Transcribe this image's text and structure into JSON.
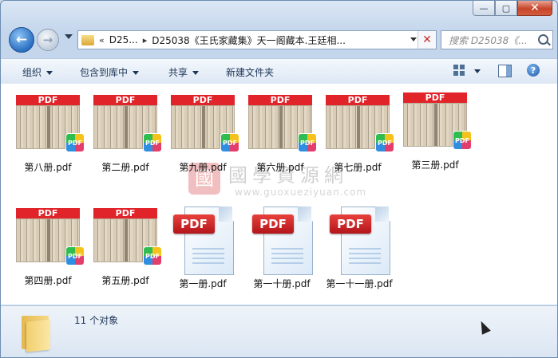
{
  "window": {
    "minimize_label": "—",
    "maximize_label": "▢",
    "close_label": "✕"
  },
  "navigation": {
    "back_glyph": "←",
    "forward_glyph": "→",
    "address": {
      "overflow_glyph": "«",
      "crumbs": [
        "D25...",
        "D25038《王氏家藏集》天一阁藏本.王廷相..."
      ],
      "clear_glyph": "✕"
    },
    "search": {
      "placeholder": "搜索 D25038《..."
    }
  },
  "toolbar": {
    "organize_label": "组织",
    "include_label": "包含到库中",
    "share_label": "共享",
    "new_folder_label": "新建文件夹",
    "help_glyph": "?"
  },
  "files": [
    {
      "name": "第八册.pdf",
      "type": "thumbnail"
    },
    {
      "name": "第二册.pdf",
      "type": "thumbnail"
    },
    {
      "name": "第九册.pdf",
      "type": "thumbnail"
    },
    {
      "name": "第六册.pdf",
      "type": "thumbnail"
    },
    {
      "name": "第七册.pdf",
      "type": "thumbnail"
    },
    {
      "name": "第三册.pdf",
      "type": "thumbnail"
    },
    {
      "name": "第四册.pdf",
      "type": "thumbnail"
    },
    {
      "name": "第五册.pdf",
      "type": "thumbnail"
    },
    {
      "name": "第一册.pdf",
      "type": "pdf-icon"
    },
    {
      "name": "第一十册.pdf",
      "type": "pdf-icon"
    },
    {
      "name": "第一十一册.pdf",
      "type": "pdf-icon"
    }
  ],
  "thumbnail_header": "PDF",
  "thumbnail_badge": "PDF",
  "pdf_icon_label": "PDF",
  "watermark": {
    "seal": "國",
    "title": "國學資源網",
    "url": "www.guoxueziyuan.com"
  },
  "details": {
    "count_text": "11 个对象"
  }
}
